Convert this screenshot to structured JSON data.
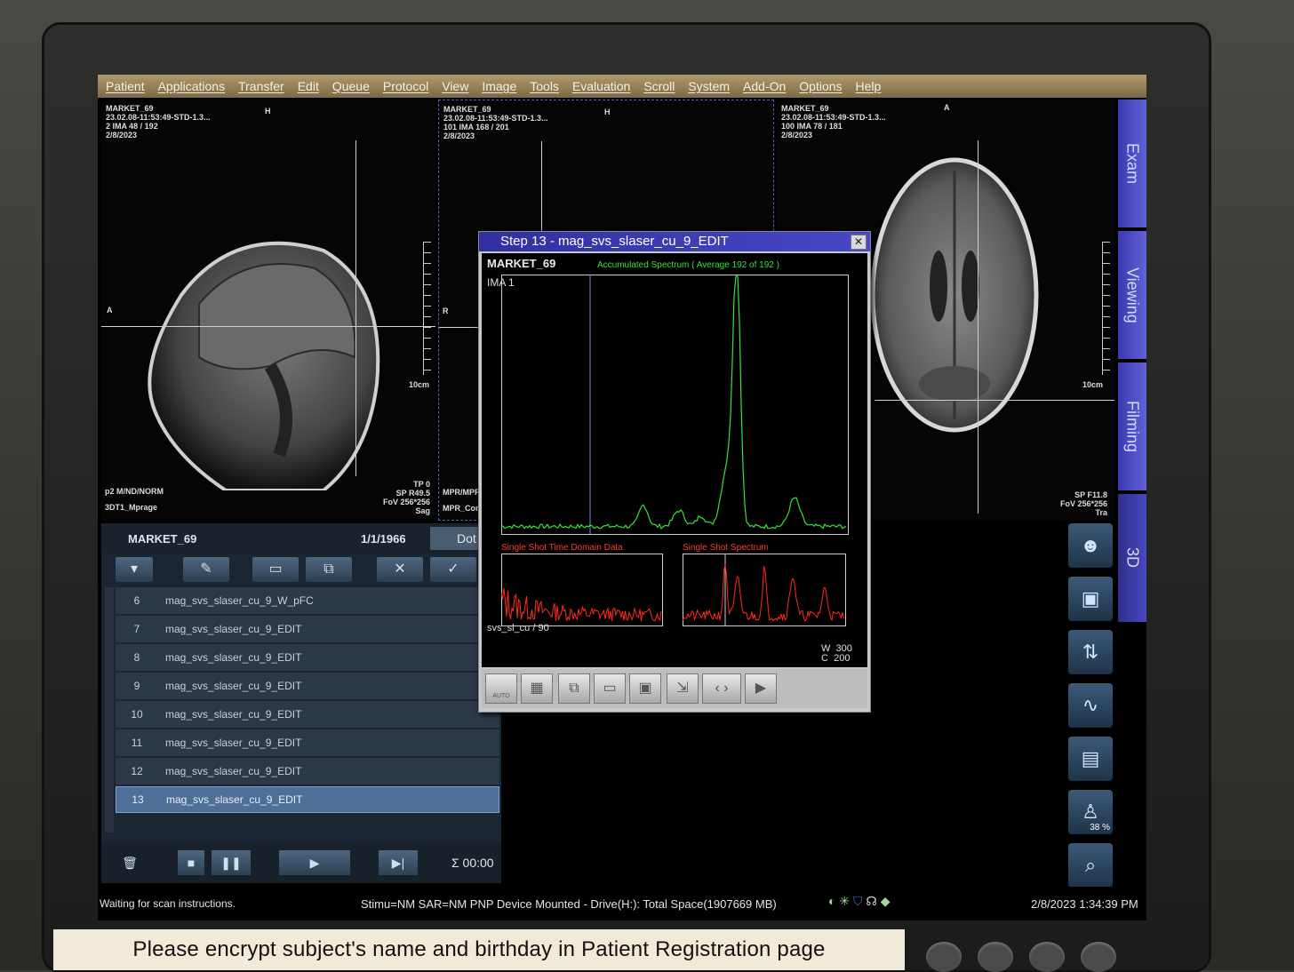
{
  "menu": [
    "Patient",
    "Applications",
    "Transfer",
    "Edit",
    "Queue",
    "Protocol",
    "View",
    "Image",
    "Tools",
    "Evaluation",
    "Scroll",
    "System",
    "Add-On",
    "Options",
    "Help"
  ],
  "viewports": [
    {
      "patient": "MARKET_69",
      "study": "23.02.08-11:53:49-STD-1.3...",
      "image": "2 IMA 48 / 192",
      "date": "2/8/2023",
      "top_label": "H",
      "left_label": "A",
      "scale": "10cm",
      "foot_left_1": "p2 M/ND/NORM",
      "foot_left_2": "3DT1_Mprage",
      "foot_right_1": "TP 0",
      "foot_right_2": "SP R49.5",
      "foot_right_3": "FoV 256*256",
      "foot_right_4": "Sag"
    },
    {
      "patient": "MARKET_69",
      "study": "23.02.08-11:53:49-STD-1.3...",
      "image": "101 IMA 168 / 201",
      "date": "2/8/2023",
      "top_label": "H",
      "left_label": "R",
      "scale": "",
      "foot_left_1": "MPR/MPR",
      "foot_left_2": "MPR_Cor"
    },
    {
      "patient": "MARKET_69",
      "study": "23.02.08-11:53:49-STD-1.3...",
      "image": "100 IMA 78 / 181",
      "date": "2/8/2023",
      "top_label": "A",
      "scale": "10cm",
      "foot_right_1": "SP F11.8",
      "foot_right_2": "FoV 256*256",
      "foot_right_3": "Tra"
    }
  ],
  "side_tabs": [
    "Exam",
    "Viewing",
    "Filming",
    "3D"
  ],
  "tool_percent": "38 %",
  "patient_browser": {
    "name": "MARKET_69",
    "dob": "1/1/1966",
    "dot_label": "Dot",
    "series": [
      {
        "num": "6",
        "name": "mag_svs_slaser_cu_9_W_pFC"
      },
      {
        "num": "7",
        "name": "mag_svs_slaser_cu_9_EDIT"
      },
      {
        "num": "8",
        "name": "mag_svs_slaser_cu_9_EDIT"
      },
      {
        "num": "9",
        "name": "mag_svs_slaser_cu_9_EDIT"
      },
      {
        "num": "10",
        "name": "mag_svs_slaser_cu_9_EDIT"
      },
      {
        "num": "11",
        "name": "mag_svs_slaser_cu_9_EDIT"
      },
      {
        "num": "12",
        "name": "mag_svs_slaser_cu_9_EDIT"
      },
      {
        "num": "13",
        "name": "mag_svs_slaser_cu_9_EDIT"
      }
    ],
    "selected": "13",
    "timer": "Σ 00:00"
  },
  "dialog": {
    "title": "Step 13 - mag_svs_slaser_cu_9_EDIT",
    "patient": "MARKET_69",
    "spectrum_label": "Accumulated Spectrum  ( Average 192 of 192 )",
    "ima": "IMA 1",
    "time_label": "Single Shot Time Domain Data",
    "single_label": "Single Shot Spectrum",
    "series_label": "svs_sl_cu / 90",
    "w_label": "W",
    "w_value": "300",
    "c_label": "C",
    "c_value": "200",
    "auto_label": "AUTO",
    "colors": {
      "spectrum": "#39e03a",
      "single": "#ff2a1a"
    }
  },
  "status": {
    "left": "Waiting for scan instructions.",
    "center": "Stimu=NM SAR=NM PNP Device Mounted - Drive(H:): Total Space(1907669 MB)",
    "datetime": "2/8/2023 1:34:39 PM"
  },
  "sticker": "Please encrypt subject's name and birthday in Patient Registration page"
}
